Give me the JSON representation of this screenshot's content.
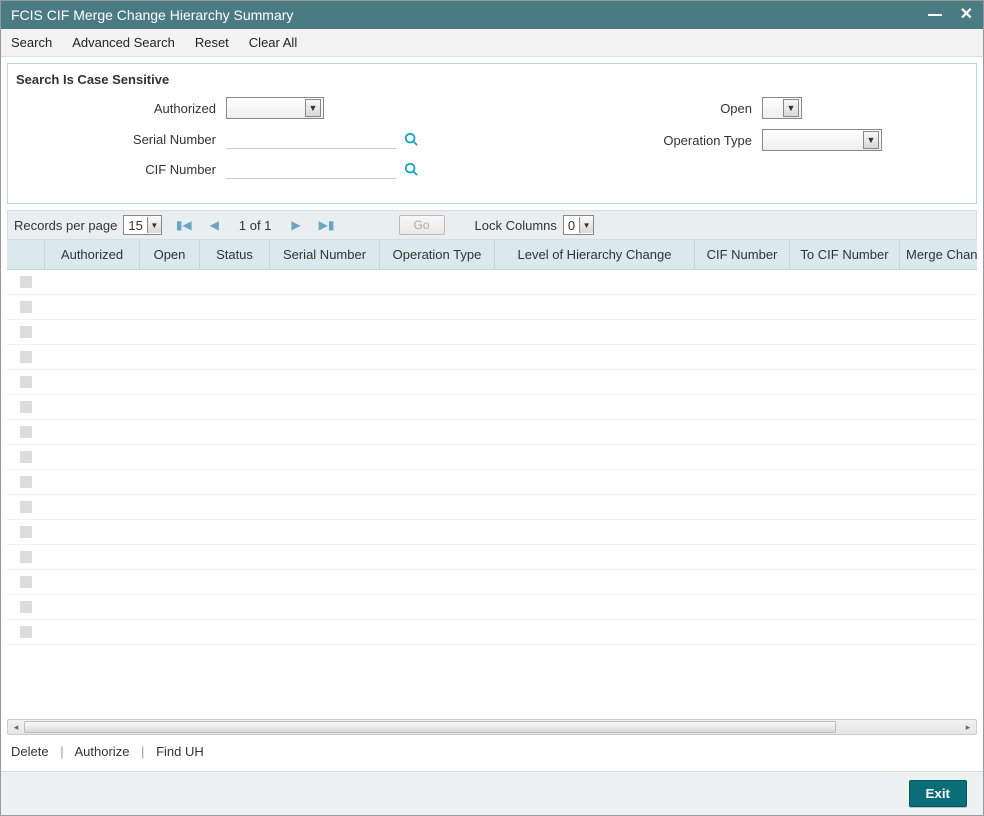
{
  "titlebar": {
    "title": "FCIS CIF Merge Change Hierarchy Summary"
  },
  "menubar": {
    "search": "Search",
    "advanced": "Advanced Search",
    "reset": "Reset",
    "clear": "Clear All"
  },
  "searchbox": {
    "heading": "Search Is Case Sensitive",
    "authorized_label": "Authorized",
    "serial_label": "Serial Number",
    "cif_label": "CIF Number",
    "open_label": "Open",
    "optype_label": "Operation Type"
  },
  "pager": {
    "records_label": "Records per page",
    "records_value": "15",
    "page_text": "1  of  1",
    "go_label": "Go",
    "lock_label": "Lock Columns",
    "lock_value": "0"
  },
  "columns": {
    "c1": "Authorized",
    "c2": "Open",
    "c3": "Status",
    "c4": "Serial Number",
    "c5": "Operation Type",
    "c6": "Level of Hierarchy Change",
    "c7": "CIF Number",
    "c8": "To CIF Number",
    "c9": "Merge Chang"
  },
  "row_count": 15,
  "actions": {
    "delete": "Delete",
    "authorize": "Authorize",
    "finduh": "Find UH"
  },
  "footer": {
    "exit": "Exit"
  }
}
